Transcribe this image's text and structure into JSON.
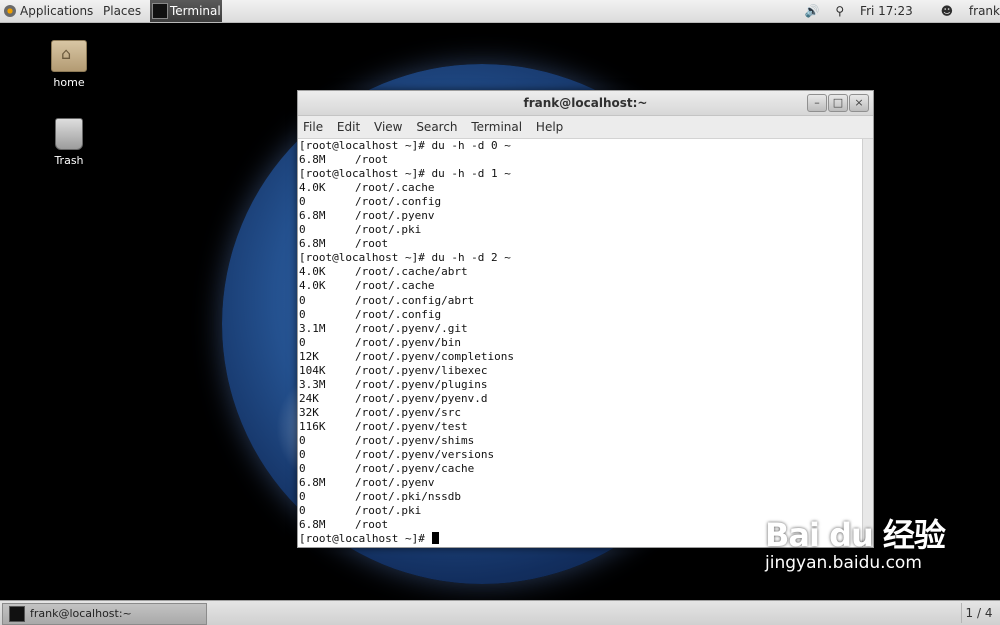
{
  "top_panel": {
    "applications_label": "Applications",
    "places_label": "Places",
    "terminal_label": "Terminal",
    "clock": "Fri 17:23",
    "user": "frank"
  },
  "desktop": {
    "icons": [
      {
        "label": "home"
      },
      {
        "label": "Trash"
      }
    ]
  },
  "window": {
    "title": "frank@localhost:~",
    "menu": [
      "File",
      "Edit",
      "View",
      "Search",
      "Terminal",
      "Help"
    ],
    "buttons": {
      "minimize": "–",
      "maximize": "□",
      "close": "×"
    }
  },
  "terminal": {
    "lines": [
      {
        "prompt": "[root@localhost ~]# du -h -d 0 ~"
      },
      {
        "size": "6.8M",
        "path": "/root"
      },
      {
        "prompt": "[root@localhost ~]# du -h -d 1 ~"
      },
      {
        "size": "4.0K",
        "path": "/root/.cache"
      },
      {
        "size": "0",
        "path": "/root/.config"
      },
      {
        "size": "6.8M",
        "path": "/root/.pyenv"
      },
      {
        "size": "0",
        "path": "/root/.pki"
      },
      {
        "size": "6.8M",
        "path": "/root"
      },
      {
        "prompt": "[root@localhost ~]# du -h -d 2 ~"
      },
      {
        "size": "4.0K",
        "path": "/root/.cache/abrt"
      },
      {
        "size": "4.0K",
        "path": "/root/.cache"
      },
      {
        "size": "0",
        "path": "/root/.config/abrt"
      },
      {
        "size": "0",
        "path": "/root/.config"
      },
      {
        "size": "3.1M",
        "path": "/root/.pyenv/.git"
      },
      {
        "size": "0",
        "path": "/root/.pyenv/bin"
      },
      {
        "size": "12K",
        "path": "/root/.pyenv/completions"
      },
      {
        "size": "104K",
        "path": "/root/.pyenv/libexec"
      },
      {
        "size": "3.3M",
        "path": "/root/.pyenv/plugins"
      },
      {
        "size": "24K",
        "path": "/root/.pyenv/pyenv.d"
      },
      {
        "size": "32K",
        "path": "/root/.pyenv/src"
      },
      {
        "size": "116K",
        "path": "/root/.pyenv/test"
      },
      {
        "size": "0",
        "path": "/root/.pyenv/shims"
      },
      {
        "size": "0",
        "path": "/root/.pyenv/versions"
      },
      {
        "size": "0",
        "path": "/root/.pyenv/cache"
      },
      {
        "size": "6.8M",
        "path": "/root/.pyenv"
      },
      {
        "size": "0",
        "path": "/root/.pki/nssdb"
      },
      {
        "size": "0",
        "path": "/root/.pki"
      },
      {
        "size": "6.8M",
        "path": "/root"
      },
      {
        "prompt": "[root@localhost ~]# "
      }
    ]
  },
  "bottom_panel": {
    "task_label": "frank@localhost:~",
    "workspace": "1 / 4"
  },
  "watermark": {
    "brand": "Bai du 经验",
    "url": "jingyan.baidu.com"
  }
}
